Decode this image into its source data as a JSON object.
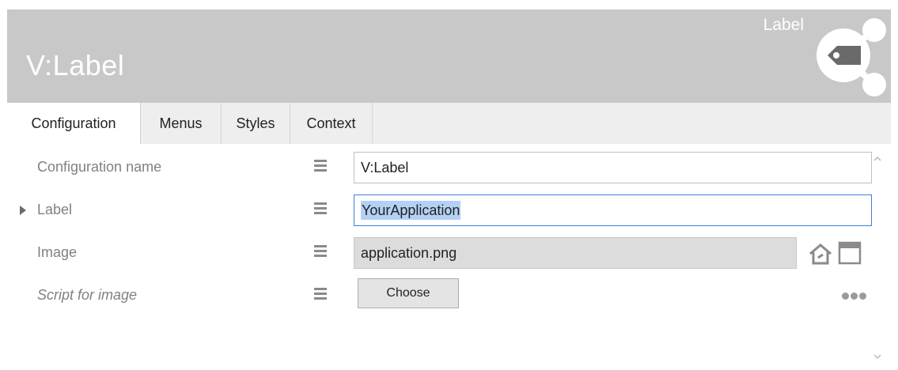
{
  "header": {
    "title": "V:Label",
    "type_label": "Label",
    "logo_icon": "tag-share-icon"
  },
  "tabs": [
    {
      "label": "Configuration",
      "active": true
    },
    {
      "label": "Menus",
      "active": false
    },
    {
      "label": "Styles",
      "active": false
    },
    {
      "label": "Context",
      "active": false
    }
  ],
  "properties": {
    "config_name": {
      "label": "Configuration name",
      "value": "V:Label"
    },
    "label": {
      "label": "Label",
      "value": "YourApplication",
      "expandable": true
    },
    "image": {
      "label": "Image",
      "value": "application.png",
      "icons": [
        "home-folder-icon",
        "window-icon"
      ]
    },
    "script_image": {
      "label": "Script for image",
      "button_label": "Choose",
      "more_icon": "more-dots-icon"
    }
  },
  "colors": {
    "header_bg": "#c8c8c8",
    "accent": "#3c7fd6",
    "selection": "#b3d1f4"
  }
}
